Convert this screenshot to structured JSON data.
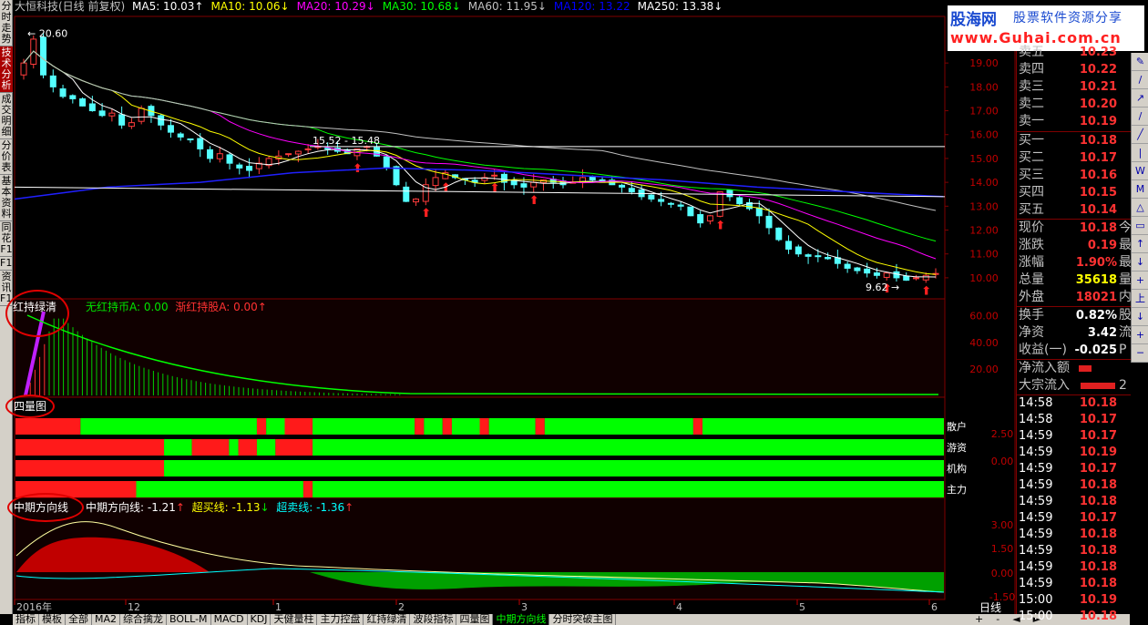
{
  "chart_title": "大恒科技(日线 前复权)",
  "ma_legend": [
    {
      "label": "MA5: 10.03",
      "arrow": "↑",
      "color": "#ffffff"
    },
    {
      "label": "MA10: 10.06",
      "arrow": "↓",
      "color": "#ffff00"
    },
    {
      "label": "MA20: 10.29",
      "arrow": "↓",
      "color": "#ff00ff"
    },
    {
      "label": "MA30: 10.68",
      "arrow": "↓",
      "color": "#00ff00"
    },
    {
      "label": "MA60: 11.95",
      "arrow": "↓",
      "color": "#c0c0c0"
    },
    {
      "label": "MA120: 13.22",
      "arrow": "",
      "color": "#0000ff"
    },
    {
      "label": "MA250: 13.38",
      "arrow": "↓",
      "color": "#ffffff"
    }
  ],
  "price_axis": [
    "19.00",
    "18.00",
    "17.00",
    "16.00",
    "15.00",
    "14.00",
    "13.00",
    "12.00",
    "11.00",
    "10.00"
  ],
  "annotations": {
    "high": "20.60",
    "low": "9.62",
    "range": "15.52 - 15.48"
  },
  "indicator1": {
    "name": "红持绿清",
    "line_a": "无红持币A: 0.00",
    "line_b": "渐红持股A: 0.00",
    "line_b_arrow": "↑",
    "axis": [
      "60.00",
      "40.00",
      "20.00"
    ]
  },
  "indicator2": {
    "name": "四量图",
    "rows": [
      "散户",
      "游资",
      "机构",
      "主力"
    ],
    "axis": [
      "2.50",
      "0.00"
    ]
  },
  "indicator3": {
    "name": "中期方向线",
    "line_main": "中期方向线: -1.21",
    "line_main_arrow": "↑",
    "line_buy": "超买线: -1.13",
    "line_buy_arrow": "↓",
    "line_sell": "超卖线: -1.36",
    "line_sell_arrow": "↑",
    "axis": [
      "3.00",
      "1.50",
      "0.00",
      "-1.50"
    ]
  },
  "time_axis": [
    "2016年",
    "12",
    "1",
    "2",
    "3",
    "4",
    "5",
    "6"
  ],
  "period_label": "日线",
  "left_tabs": [
    {
      "label": "分时走势",
      "active": false
    },
    {
      "label": "技术分析",
      "active": true
    },
    {
      "label": "成交明细",
      "active": false
    },
    {
      "label": "分价表",
      "active": false
    },
    {
      "label": "基本资料",
      "active": false
    },
    {
      "label": "同花F1",
      "active": false
    },
    {
      "label": "F10",
      "active": false
    },
    {
      "label": "资讯F10",
      "active": false
    }
  ],
  "bottom_tabs": [
    {
      "label": "指标",
      "active": false
    },
    {
      "label": "模板",
      "active": false
    },
    {
      "label": "全部",
      "active": false
    },
    {
      "label": "MA2",
      "active": false
    },
    {
      "label": "综合擒龙",
      "active": false
    },
    {
      "label": "BOLL-M",
      "active": false
    },
    {
      "label": "MACD",
      "active": false
    },
    {
      "label": "KDJ",
      "active": false
    },
    {
      "label": "天健量柱",
      "active": false
    },
    {
      "label": "主力控盘",
      "active": false
    },
    {
      "label": "红持绿清",
      "active": false
    },
    {
      "label": "波段指标",
      "active": false
    },
    {
      "label": "四量图",
      "active": false
    },
    {
      "label": "中期方向线",
      "active": true
    },
    {
      "label": "分时突破主图",
      "active": false
    }
  ],
  "watermark": {
    "brand": "股海网",
    "slogan": "股票软件资源分享",
    "url": "www.Guhai.com.cn"
  },
  "order_book": {
    "sell": [
      {
        "label": "卖五",
        "price": "10.23"
      },
      {
        "label": "卖四",
        "price": "10.22"
      },
      {
        "label": "卖三",
        "price": "10.21"
      },
      {
        "label": "卖二",
        "price": "10.20"
      },
      {
        "label": "卖一",
        "price": "10.19"
      }
    ],
    "buy": [
      {
        "label": "买一",
        "price": "10.18"
      },
      {
        "label": "买二",
        "price": "10.17"
      },
      {
        "label": "买三",
        "price": "10.16"
      },
      {
        "label": "买四",
        "price": "10.15"
      },
      {
        "label": "买五",
        "price": "10.14"
      }
    ]
  },
  "quote": [
    {
      "label": "现价",
      "value": "10.18",
      "color": "red",
      "extra": "今"
    },
    {
      "label": "涨跌",
      "value": "0.19",
      "color": "red",
      "extra": "最"
    },
    {
      "label": "涨幅",
      "value": "1.90%",
      "color": "red",
      "extra": "最"
    },
    {
      "label": "总量",
      "value": "35618",
      "color": "yellow",
      "extra": "量"
    },
    {
      "label": "外盘",
      "value": "18021",
      "color": "red",
      "extra": "内"
    }
  ],
  "stats": [
    {
      "label": "换手",
      "value": "0.82%",
      "extra": "股"
    },
    {
      "label": "净资",
      "value": "3.42",
      "extra": "流"
    },
    {
      "label": "收益(一)",
      "value": "-0.025",
      "extra": "P"
    }
  ],
  "flows": [
    {
      "label": "净流入额",
      "extra": ""
    },
    {
      "label": "大宗流入",
      "extra": "2"
    }
  ],
  "ticks": [
    {
      "time": "14:58",
      "price": "10.18"
    },
    {
      "time": "14:58",
      "price": "10.17"
    },
    {
      "time": "14:59",
      "price": "10.17"
    },
    {
      "time": "14:59",
      "price": "10.19"
    },
    {
      "time": "14:59",
      "price": "10.17"
    },
    {
      "time": "14:59",
      "price": "10.18"
    },
    {
      "time": "14:59",
      "price": "10.18"
    },
    {
      "time": "14:59",
      "price": "10.17"
    },
    {
      "time": "14:59",
      "price": "10.18"
    },
    {
      "time": "14:59",
      "price": "10.18"
    },
    {
      "time": "14:59",
      "price": "10.18"
    },
    {
      "time": "14:59",
      "price": "10.18"
    },
    {
      "time": "15:00",
      "price": "10.19"
    },
    {
      "time": "15:00",
      "price": "10.18"
    }
  ],
  "chart_data": {
    "type": "candlestick",
    "ylim": [
      9.5,
      20.8
    ],
    "closes": [
      19.0,
      20.0,
      18.5,
      18.0,
      17.6,
      17.5,
      17.2,
      17.0,
      16.8,
      16.9,
      16.4,
      16.5,
      17.1,
      16.8,
      16.4,
      16.1,
      15.9,
      15.8,
      15.4,
      15.0,
      15.2,
      14.8,
      14.6,
      14.5,
      14.8,
      15.0,
      15.1,
      15.2,
      15.3,
      15.4,
      15.5,
      15.4,
      15.3,
      15.2,
      15.4,
      15.5,
      15.1,
      14.6,
      13.9,
      13.2,
      13.3,
      13.9,
      14.2,
      14.4,
      14.2,
      14.1,
      14.0,
      14.2,
      14.3,
      14.0,
      13.9,
      13.8,
      14.0,
      14.1,
      14.0,
      13.9,
      14.0,
      14.2,
      14.1,
      14.0,
      13.9,
      13.8,
      13.6,
      13.4,
      13.3,
      13.2,
      13.1,
      13.0,
      12.6,
      12.3,
      12.6,
      13.6,
      13.4,
      13.1,
      12.9,
      12.6,
      12.1,
      11.6,
      11.2,
      11.0,
      10.9,
      10.9,
      10.8,
      10.6,
      10.4,
      10.3,
      10.2,
      10.1,
      10.2,
      10.0,
      9.9,
      10.0,
      10.1,
      10.18
    ]
  }
}
